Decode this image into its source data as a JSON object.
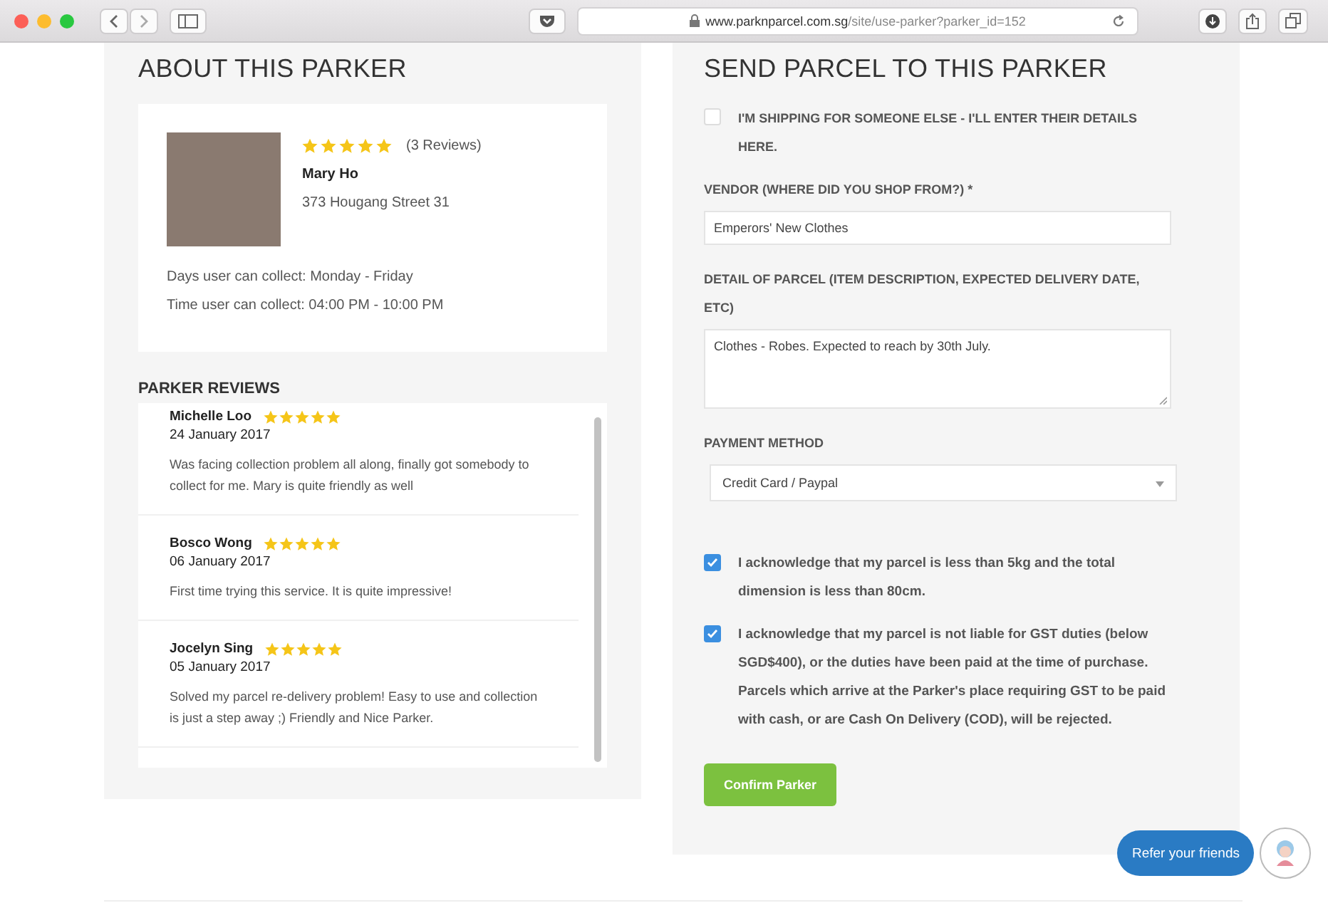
{
  "browser": {
    "url_host": "www.parknparcel.com.sg",
    "url_path": "/site/use-parker?parker_id=152"
  },
  "about": {
    "title": "ABOUT THIS PARKER",
    "stars": 5,
    "review_count": "(3 Reviews)",
    "name": "Mary Ho",
    "address": "373 Hougang Street 31",
    "details": [
      "Days user can collect: Monday - Friday",
      "Time user can collect: 04:00 PM - 10:00 PM"
    ]
  },
  "reviews": {
    "title": "PARKER REVIEWS",
    "items": [
      {
        "name": "Michelle Loo",
        "stars": 5,
        "date": "24 January 2017",
        "text": "Was facing collection problem all along, finally got somebody to collect for me. Mary is quite friendly as well"
      },
      {
        "name": "Bosco Wong",
        "stars": 5,
        "date": "06 January 2017",
        "text": "First time trying this service. It is quite impressive!"
      },
      {
        "name": "Jocelyn Sing",
        "stars": 5,
        "date": "05 January 2017",
        "text": "Solved my parcel re-delivery problem! Easy to use and collection is just a step away ;) Friendly and Nice Parker."
      }
    ]
  },
  "form": {
    "title": "SEND PARCEL TO THIS PARKER",
    "shipping_for_else": {
      "label": "I'M SHIPPING FOR SOMEONE ELSE - I'LL ENTER THEIR DETAILS HERE.",
      "checked": false
    },
    "vendor": {
      "label": "VENDOR (WHERE DID YOU SHOP FROM?) *",
      "value": "Emperors' New Clothes"
    },
    "detail": {
      "label": "DETAIL OF PARCEL (ITEM DESCRIPTION, EXPECTED DELIVERY DATE, ETC)",
      "value": "Clothes - Robes. Expected to reach by 30th July."
    },
    "payment": {
      "label": "PAYMENT METHOD",
      "value": "Credit Card / Paypal"
    },
    "acknowledgements": [
      {
        "label": "I acknowledge that my parcel is less than 5kg and the total dimension is less than 80cm.",
        "checked": true
      },
      {
        "label": "I acknowledge that my parcel is not liable for GST duties (below SGD$400), or the duties have been paid at the time of purchase. Parcels which arrive at the Parker's place requiring GST to be paid with cash, or are Cash On Delivery (COD), will be rejected.",
        "checked": true
      }
    ],
    "submit": "Confirm Parker"
  },
  "refer": {
    "label": "Refer your friends"
  }
}
